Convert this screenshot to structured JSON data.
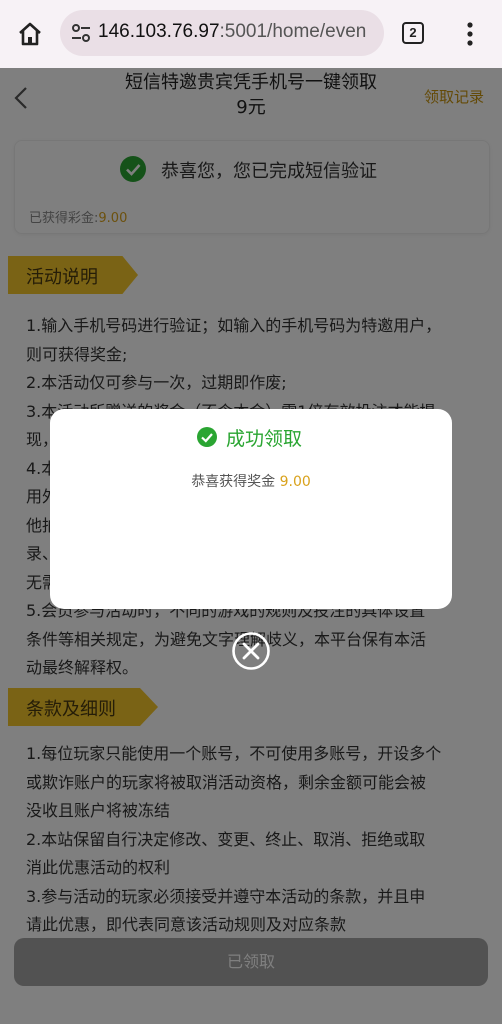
{
  "browser": {
    "url_host": "146.103.76.97",
    "url_rest": ":5001/home/even",
    "tab_count": "2"
  },
  "header": {
    "title_line1": "短信特邀贵宾凭手机号一键领取",
    "title_line2": "9元",
    "records_link": "领取记录"
  },
  "verify": {
    "message": "恭喜您，您已完成短信验证",
    "earned_label": "已获得彩金:",
    "earned_value": "9.00"
  },
  "section1": {
    "tag": "活动说明",
    "lines": [
      "1.输入手机号码进行验证；如输入的手机号码为特邀用户，",
      "则可获得奖金;",
      "2.本活动仅可参与一次，过期即作废;",
      "3.本活动所赠送的奖金（不含本金）需1倍有效投注才能提",
      "现，",
      "4.本",
      "用外",
      "他拍",
      "录、",
      "无需",
      "5.会员参与活动时，不同的游戏的规则及投注的具体设置",
      "条件等相关规定，为避免文字理解歧义，本平台保有本活",
      "动最终解释权。"
    ]
  },
  "section2": {
    "tag": "条款及细则",
    "lines": [
      "1.每位玩家只能使用一个账号，不可使用多账号，开设多个",
      "或欺诈账户的玩家将被取消活动资格，剩余金额可能会被",
      "没收且账户将被冻结",
      "2.本站保留自行决定修改、变更、终止、取消、拒绝或取",
      "消此优惠活动的权利",
      "3.参与活动的玩家必须接受并遵守本活动的条款，并且申",
      "请此优惠，即代表同意该活动规则及对应条款"
    ]
  },
  "bottom": {
    "button_label": "已领取"
  },
  "modal": {
    "title": "成功领取",
    "message": "恭喜获得奖金",
    "amount": "9.00"
  },
  "colors": {
    "accent_gold": "#f5c62b",
    "success_green": "#2aa532",
    "amount_gold": "#d9a21c"
  }
}
